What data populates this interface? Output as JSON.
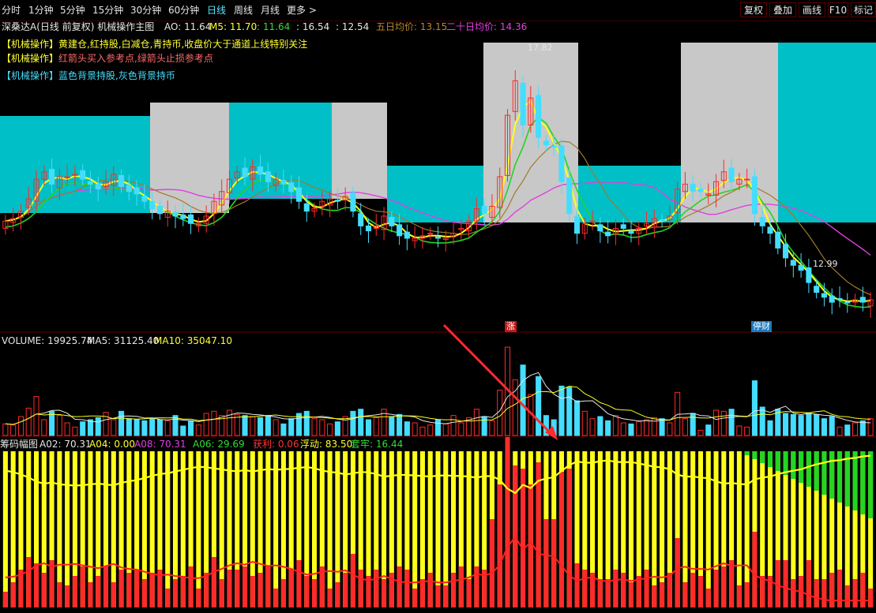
{
  "toolbar": {
    "timeframes": [
      "分时",
      "1分钟",
      "5分钟",
      "15分钟",
      "30分钟",
      "60分钟",
      "日线",
      "周线",
      "月线",
      "更多 >"
    ],
    "active": "日线",
    "right_buttons": [
      "复权",
      "叠加",
      "画线",
      "F10",
      "标记"
    ]
  },
  "main_header": {
    "title": "深桑达A(日线 前复权) 机械操作主图",
    "ao": "AO: 11.64",
    "m5": "M5: 11.70",
    "v3": ": 11.64",
    "v4": ": 16.54",
    "v5": ": 12.54",
    "ma5_label": "五日均价: 13.15",
    "ma20_label": "二十日均价: 14.36"
  },
  "annotations": [
    {
      "tag": "【机械操作】",
      "text": "黄建仓,红持股,白减仓,青持币,收盘价大于通道上线特别关注",
      "color": "#ffff33"
    },
    {
      "tag": "【机械操作】",
      "text": "红箭头买入参考点,绿箭头止损参考点",
      "color": "#ff6a6a"
    },
    {
      "tag": "【机械操作】",
      "text": "蓝色背景持股,灰色背景持币",
      "color": "#44ddff"
    }
  ],
  "price_labels": {
    "high": "17.82",
    "low": "12.99"
  },
  "markers": {
    "zhang": "涨",
    "caicai": "停财"
  },
  "volume_header": {
    "label": "VOLUME: 19925.74",
    "ma5": "MA5: 31125.40",
    "ma10": "MA10: 35047.10"
  },
  "chip_header": {
    "title": "筹码幅图",
    "a02": "A02: 70.31",
    "a04": "A04: 0.00",
    "a08": "A08: 70.31",
    "a06": "A06: 29.69",
    "profit": "获利: 0.06",
    "float": "浮动: 83.50",
    "trapped": "套牢: 16.44"
  },
  "colors": {
    "up": "#ff2a2a",
    "down": "#44ddff",
    "bg_hold": "#00bfc6",
    "bg_cash": "#c8c8c8",
    "yellow": "#ffff1a",
    "green": "#22d622",
    "magenta": "#e040e0",
    "brown": "#a07a2a"
  },
  "chart_data": {
    "type": "candlestick",
    "regions": [
      "hold",
      "cash",
      "hold",
      "cash",
      "hold",
      "cash",
      "hold",
      "cash",
      "hold",
      "cash"
    ],
    "close": [
      10.9,
      11.0,
      11.3,
      11.8,
      12.6,
      12.9,
      12.4,
      12.7,
      12.7,
      12.8,
      12.6,
      12.4,
      12.2,
      12.5,
      12.8,
      12.3,
      12.1,
      12.0,
      11.7,
      11.4,
      11.2,
      11.3,
      11.1,
      11.0,
      10.8,
      10.8,
      11.1,
      11.7,
      12.1,
      12.6,
      12.9,
      12.7,
      13.1,
      12.8,
      12.5,
      12.6,
      12.4,
      12.1,
      11.7,
      11.3,
      11.4,
      11.7,
      11.8,
      11.7,
      11.9,
      11.3,
      10.7,
      10.5,
      10.7,
      11.1,
      10.7,
      10.3,
      10.2,
      10.2,
      10.3,
      10.4,
      10.2,
      10.2,
      10.4,
      10.6,
      10.9,
      11.4,
      11.2,
      11.5,
      12.7,
      15.2,
      16.6,
      14.8,
      15.9,
      14.3,
      14.0,
      13.9,
      12.5,
      11.2,
      10.4,
      10.8,
      10.9,
      10.5,
      10.3,
      10.6,
      10.6,
      10.4,
      10.6,
      10.8,
      11.0,
      10.9,
      11.1,
      12.2,
      12.4,
      12.1,
      12.1,
      12.0,
      12.5,
      12.9,
      12.5,
      12.6,
      12.6,
      11.2,
      10.7,
      10.4,
      9.8,
      9.4,
      9.1,
      8.9,
      8.4,
      8.0,
      7.8,
      7.6,
      7.7,
      7.6,
      7.7,
      7.6,
      7.7
    ]
  }
}
